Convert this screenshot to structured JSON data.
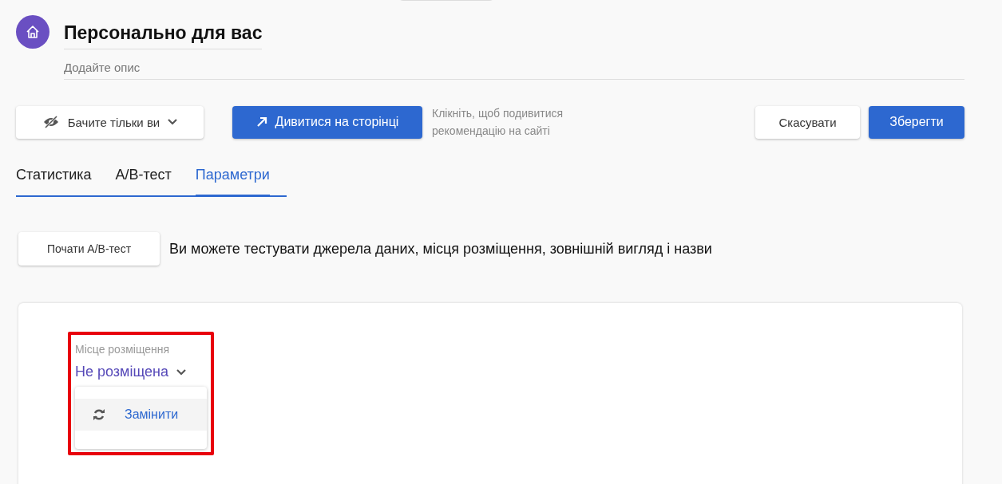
{
  "header": {
    "title": "Персонально для вас",
    "description_placeholder": "Додайте опис"
  },
  "toolbar": {
    "visibility": "Бачите тільки ви",
    "view_button": "Дивитися на сторінці",
    "hint": "Клікніть, щоб подивитися рекомендацію на сайті",
    "cancel": "Скасувати",
    "save": "Зберегти"
  },
  "tabs": [
    {
      "label": "Статистика",
      "selected": false
    },
    {
      "label": "A/B-тест",
      "selected": false
    },
    {
      "label": "Параметри",
      "selected": true
    }
  ],
  "ab": {
    "button": "Почати A/B-тест",
    "text": "Ви можете тестувати джерела даних, місця розміщення, зовнішній вигляд і назви"
  },
  "placement": {
    "label": "Місце розміщення",
    "value": "Не розміщена",
    "menu": [
      {
        "label": "Замінити"
      }
    ]
  }
}
